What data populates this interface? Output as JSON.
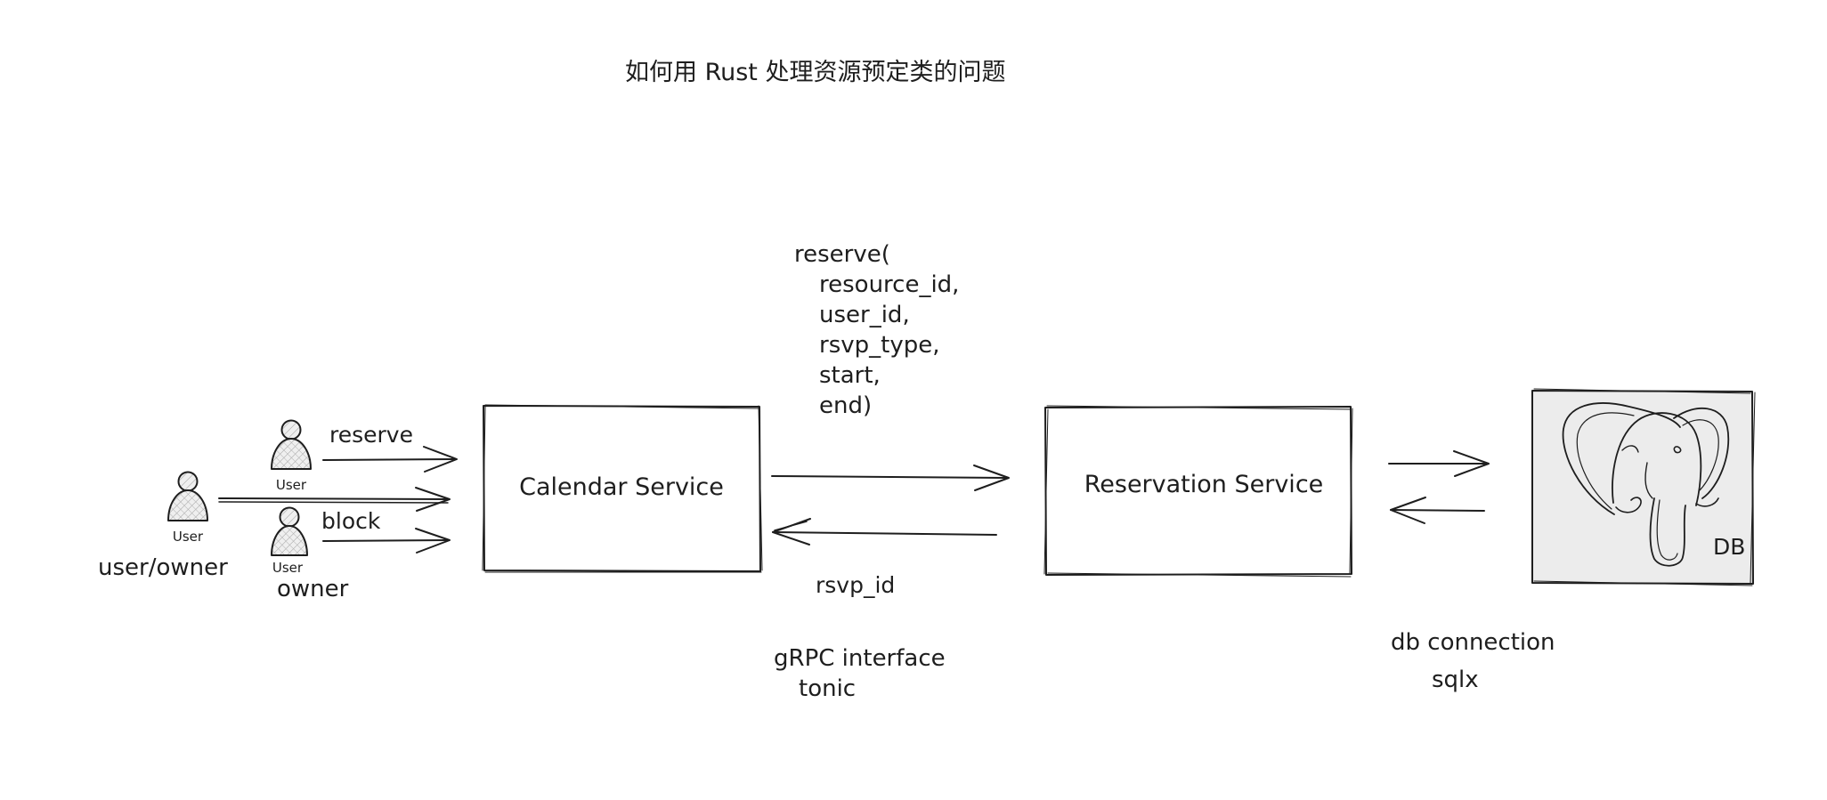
{
  "title": "如何用 Rust 处理资源预定类的问题",
  "actors": {
    "main_user": {
      "icon": "user-icon",
      "small_label": "User",
      "caption": "user/owner"
    },
    "reserve_user": {
      "icon": "user-icon",
      "small_label": "User"
    },
    "block_user": {
      "icon": "user-icon",
      "small_label": "User",
      "caption": "owner"
    }
  },
  "arrows": {
    "reserve_label": "reserve",
    "block_label": "block",
    "response_label": "rsvp_id"
  },
  "call_signature": [
    "reserve(",
    "resource_id,",
    "user_id,",
    "rsvp_type,",
    "start,",
    "end)"
  ],
  "services": {
    "calendar": "Calendar Service",
    "reservation": "Reservation Service"
  },
  "interface_note": [
    "gRPC interface",
    "tonic"
  ],
  "db": {
    "label": "DB",
    "icon": "postgresql-elephant-icon",
    "note": [
      "db connection",
      "sqlx"
    ]
  },
  "colors": {
    "stroke": "#1e1e1e",
    "db_fill": "#ececec",
    "user_fill": "#e6e6e6"
  }
}
